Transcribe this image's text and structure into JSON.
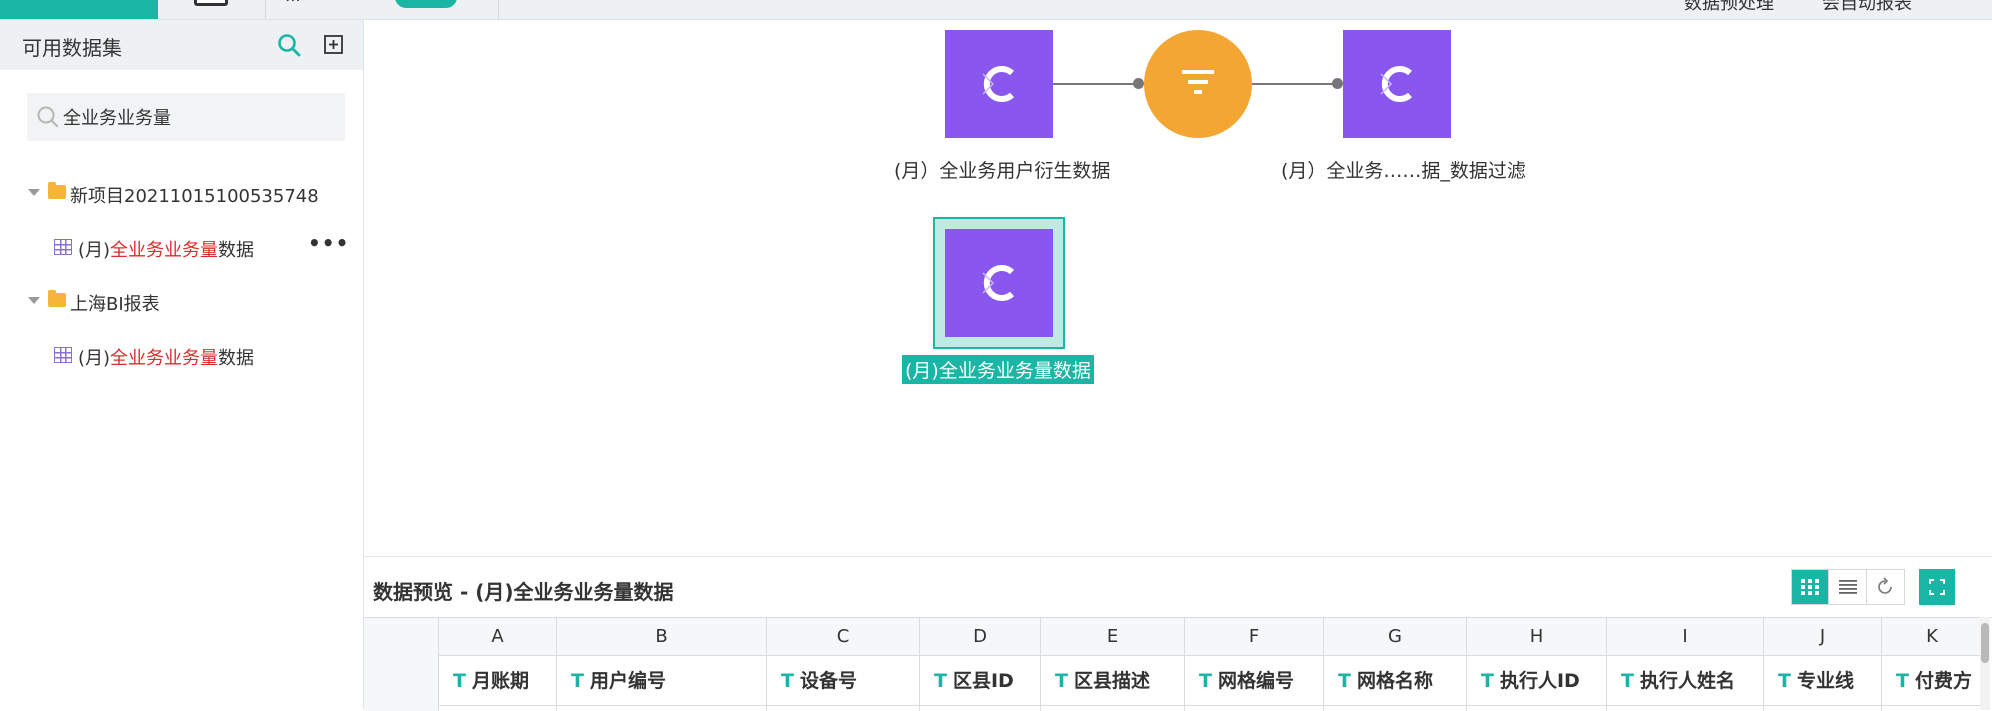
{
  "colors": {
    "accent": "#1bb5a5",
    "node_purple": "#8956ee",
    "filter_orange": "#f4a632",
    "highlight_red": "#e02b2b"
  },
  "topbar": {
    "right_items": [
      "数据预处理",
      "会自动报表"
    ]
  },
  "sidebar": {
    "title": "可用数据集",
    "search_icon": "search-icon",
    "add_icon": "add-square-icon",
    "search": {
      "value": "全业务业务量",
      "placeholder": ""
    },
    "tree": [
      {
        "type": "folder",
        "label": "新项目20211015100535748",
        "expanded": true
      },
      {
        "type": "dataset",
        "prefix": "(月)",
        "match": "全业务业务量",
        "suffix": "数据",
        "more": "•••"
      },
      {
        "type": "folder",
        "label": "上海BI报表",
        "expanded": true
      },
      {
        "type": "dataset",
        "prefix": "(月)",
        "match": "全业务业务量",
        "suffix": "数据"
      }
    ]
  },
  "canvas": {
    "nodes": [
      {
        "kind": "dataset",
        "label": "(月）全业务用户衍生数据"
      },
      {
        "kind": "filter",
        "label": ""
      },
      {
        "kind": "dataset",
        "label": "(月）全业务……据_数据过滤"
      },
      {
        "kind": "dataset",
        "label": "(月)全业务业务量数据",
        "selected": true
      }
    ]
  },
  "preview": {
    "title": "数据预览 - (月)全业务业务量数据",
    "tools": [
      "grid-view-icon",
      "list-view-icon",
      "refresh-icon"
    ],
    "fullscreen_icon": "fullscreen-icon",
    "columns": [
      {
        "letter": "A",
        "name": "月账期",
        "type": "T"
      },
      {
        "letter": "B",
        "name": "用户编号",
        "type": "T"
      },
      {
        "letter": "C",
        "name": "设备号",
        "type": "T"
      },
      {
        "letter": "D",
        "name": "区县ID",
        "type": "T"
      },
      {
        "letter": "E",
        "name": "区县描述",
        "type": "T"
      },
      {
        "letter": "F",
        "name": "网格编号",
        "type": "T"
      },
      {
        "letter": "G",
        "name": "网格名称",
        "type": "T"
      },
      {
        "letter": "H",
        "name": "执行人ID",
        "type": "T"
      },
      {
        "letter": "I",
        "name": "执行人姓名",
        "type": "T"
      },
      {
        "letter": "J",
        "name": "专业线",
        "type": "T"
      },
      {
        "letter": "K",
        "name": "付费方",
        "type": "T"
      }
    ]
  }
}
